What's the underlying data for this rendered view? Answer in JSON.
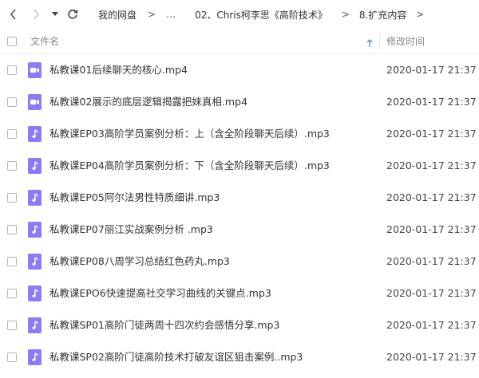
{
  "breadcrumb": {
    "items": [
      "我的网盘",
      "…",
      "02、Chris柯李思《高阶技术》",
      "8.扩充内容"
    ],
    "separator": ">"
  },
  "header": {
    "name_label": "文件名",
    "modified_label": "修改时间",
    "sort_order": "ascending"
  },
  "colors": {
    "file_icon": "#8b7cf6",
    "sort_arrow": "#4a90e2"
  },
  "files": [
    {
      "name": "私教课01后续聊天的核心.mp4",
      "type": "video",
      "icon": "video-file-icon",
      "modified": "2020-01-17 21:37"
    },
    {
      "name": "私教课02展示的底层逻辑揭露把妹真相.mp4",
      "type": "video",
      "icon": "video-file-icon",
      "modified": "2020-01-17 21:37"
    },
    {
      "name": "私教课EP03高阶学员案例分析：上（含全阶段聊天后续）.mp3",
      "type": "audio",
      "icon": "audio-file-icon",
      "modified": "2020-01-17 21:37"
    },
    {
      "name": "私教课EP04高阶学员案例分析：下（含全阶段聊天后续）.mp3",
      "type": "audio",
      "icon": "audio-file-icon",
      "modified": "2020-01-17 21:37"
    },
    {
      "name": "私教课EP05阿尔法男性特质细讲.mp3",
      "type": "audio",
      "icon": "audio-file-icon",
      "modified": "2020-01-17 21:37"
    },
    {
      "name": "私教课EP07丽江实战案例分析 .mp3",
      "type": "audio",
      "icon": "audio-file-icon",
      "modified": "2020-01-17 21:37"
    },
    {
      "name": "私教课EP08八周学习总结红色药丸.mp3",
      "type": "audio",
      "icon": "audio-file-icon",
      "modified": "2020-01-17 21:37"
    },
    {
      "name": "私教课EPO6快速提高社交学习曲线的关键点.mp3",
      "type": "audio",
      "icon": "audio-file-icon",
      "modified": "2020-01-17 21:37"
    },
    {
      "name": "私教课SP01高阶门徒两周十四次约会感悟分享.mp3",
      "type": "audio",
      "icon": "audio-file-icon",
      "modified": "2020-01-17 21:37"
    },
    {
      "name": "私教课SP02高阶门徒高阶技术打破友谊区狙击案例..mp3",
      "type": "audio",
      "icon": "audio-file-icon",
      "modified": "2020-01-17 21:37"
    }
  ]
}
